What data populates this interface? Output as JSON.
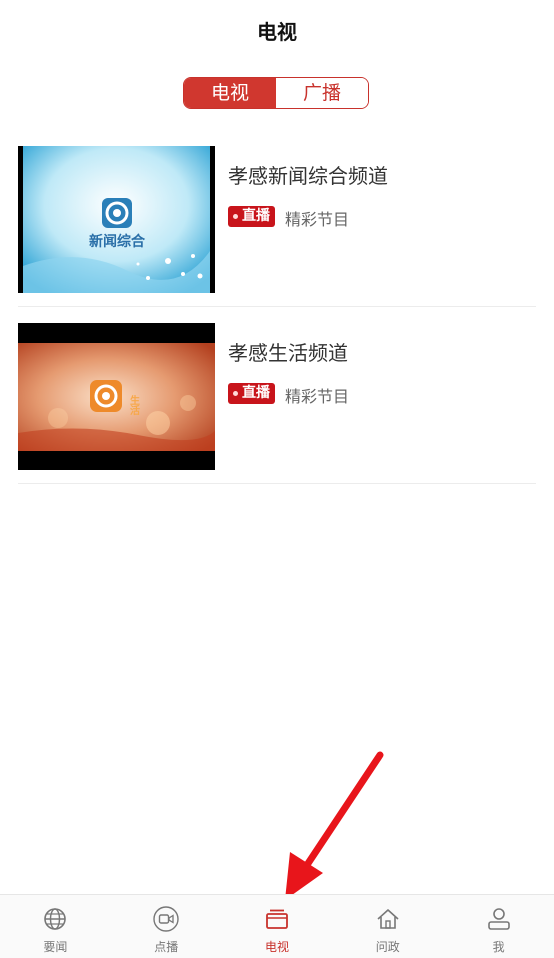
{
  "header": {
    "title": "电视"
  },
  "segment": {
    "tabs": [
      {
        "label": "电视",
        "active": true
      },
      {
        "label": "广播",
        "active": false
      }
    ]
  },
  "channels": [
    {
      "title": "孝感新闻综合频道",
      "badge": "直播",
      "subtitle": "精彩节目",
      "thumb_text": "新闻综合"
    },
    {
      "title": "孝感生活频道",
      "badge": "直播",
      "subtitle": "精彩节目",
      "thumb_text": "生活"
    }
  ],
  "tabbar": {
    "items": [
      {
        "label": "要闻",
        "icon": "globe-icon",
        "active": false
      },
      {
        "label": "点播",
        "icon": "video-icon",
        "active": false
      },
      {
        "label": "电视",
        "icon": "tv-icon",
        "active": true
      },
      {
        "label": "问政",
        "icon": "home-icon",
        "active": false
      },
      {
        "label": "我",
        "icon": "user-icon",
        "active": false
      }
    ]
  },
  "colors": {
    "accent": "#d0372f",
    "badge": "#c8141b"
  }
}
